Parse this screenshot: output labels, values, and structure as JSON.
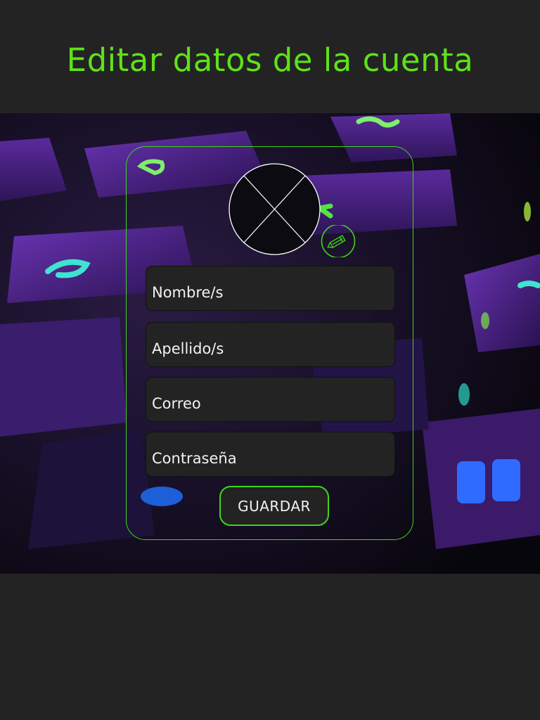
{
  "header": {
    "title": "Editar datos de la cuenta"
  },
  "profile": {
    "avatar_icon": "avatar-placeholder-icon",
    "edit_icon": "pencil-icon"
  },
  "form": {
    "fields": [
      {
        "name": "nombre",
        "placeholder": "Nombre/s",
        "value": ""
      },
      {
        "name": "apellido",
        "placeholder": "Apellido/s",
        "value": ""
      },
      {
        "name": "correo",
        "placeholder": "Correo",
        "value": ""
      },
      {
        "name": "contrasena",
        "placeholder": "Contraseña",
        "value": ""
      }
    ],
    "save_label": "GUARDAR"
  },
  "colors": {
    "accent": "#5ee21a",
    "border_accent": "#3fd51a",
    "background": "#232323",
    "text": "#f2f2f2"
  }
}
